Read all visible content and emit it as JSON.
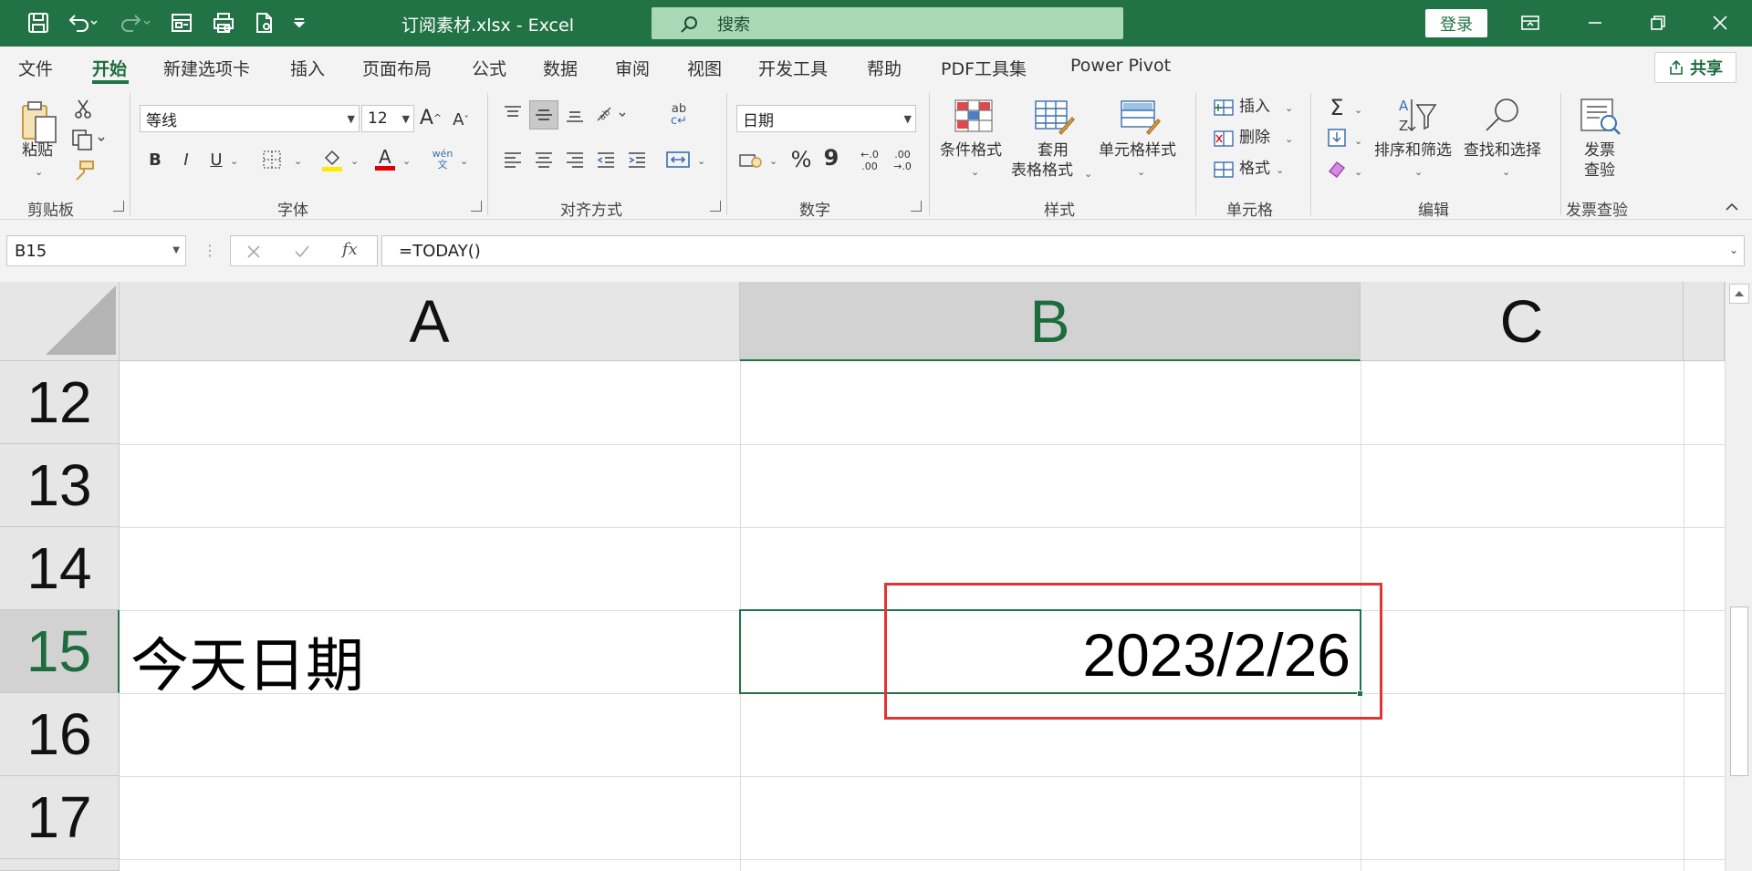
{
  "titlebar": {
    "file_title": "订阅素材.xlsx  -  Excel",
    "search_placeholder": "搜索",
    "login_label": "登录"
  },
  "tabs": [
    "文件",
    "开始",
    "新建选项卡",
    "插入",
    "页面布局",
    "公式",
    "数据",
    "审阅",
    "视图",
    "开发工具",
    "帮助",
    "PDF工具集",
    "Power Pivot"
  ],
  "active_tab": "开始",
  "share_label": "共享",
  "ribbon": {
    "clipboard": {
      "paste": "粘贴",
      "group": "剪贴板"
    },
    "font": {
      "name": "等线",
      "size": "12",
      "bold": "B",
      "italic": "I",
      "underline": "U",
      "grow": "A",
      "shrink": "A",
      "group": "字体"
    },
    "alignment": {
      "group": "对齐方式"
    },
    "number": {
      "format": "日期",
      "percent": "%",
      "comma": "9",
      "group": "数字"
    },
    "styles": {
      "conditional": "条件格式",
      "table_format_1": "套用",
      "table_format_2": "表格格式",
      "cell_styles": "单元格样式",
      "group": "样式"
    },
    "cells": {
      "insert": "插入",
      "delete": "删除",
      "format": "格式",
      "group": "单元格"
    },
    "editing": {
      "sum": "Σ",
      "sort": "排序和筛选",
      "find": "查找和选择",
      "group": "编辑"
    },
    "invoice": {
      "check_1": "发票",
      "check_2": "查验",
      "group": "发票查验"
    }
  },
  "formula_bar": {
    "name_box": "B15",
    "formula": "=TODAY()",
    "fx": "fx"
  },
  "grid": {
    "columns": [
      "A",
      "B",
      "C"
    ],
    "selected_column": "B",
    "rows": [
      "12",
      "13",
      "14",
      "15",
      "16",
      "17"
    ],
    "selected_row": "15",
    "cells": {
      "A15": "今天日期",
      "B15": "2023/2/26"
    }
  },
  "colors": {
    "excel_green": "#217346",
    "highlight_box": "#e53333"
  }
}
